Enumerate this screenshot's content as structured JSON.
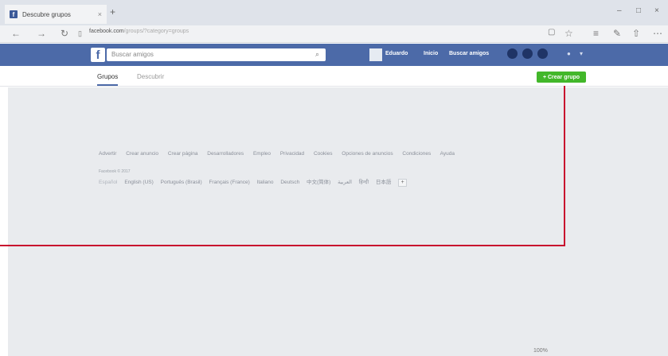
{
  "browser": {
    "tab_title": "Descubre grupos",
    "tab_close": "×",
    "new_tab": "+",
    "window_controls": [
      "–",
      "□",
      "×"
    ],
    "url_domain": "facebook.com",
    "url_rest": "/groups/?category=groups",
    "nav": {
      "back": "←",
      "forward": "→",
      "reload": "↻"
    }
  },
  "facebook": {
    "logo": "f",
    "search_placeholder": "Buscar amigos",
    "nav_links": [
      "Eduardo",
      "Inicio",
      "Buscar amigos"
    ],
    "brand_color": "#4c6aa8"
  },
  "subheader": {
    "tabs": [
      "Grupos",
      "Descubrir"
    ],
    "create_button": "+ Crear grupo"
  },
  "footer": {
    "links": [
      "Advertir",
      "Crear anuncio",
      "Crear página",
      "Desarrolladores",
      "Empleo",
      "Privacidad",
      "Cookies",
      "Opciones de anuncios",
      "Condiciones",
      "Ayuda"
    ],
    "copyright": "Facebook © 2017",
    "languages": [
      "Español",
      "English (US)",
      "Português (Brasil)",
      "Français (France)",
      "Italiano",
      "Deutsch",
      "中文(简体)",
      "العربية",
      "हिन्दी",
      "日本語"
    ],
    "more_languages": "+"
  },
  "status": {
    "bottom": "100%"
  }
}
